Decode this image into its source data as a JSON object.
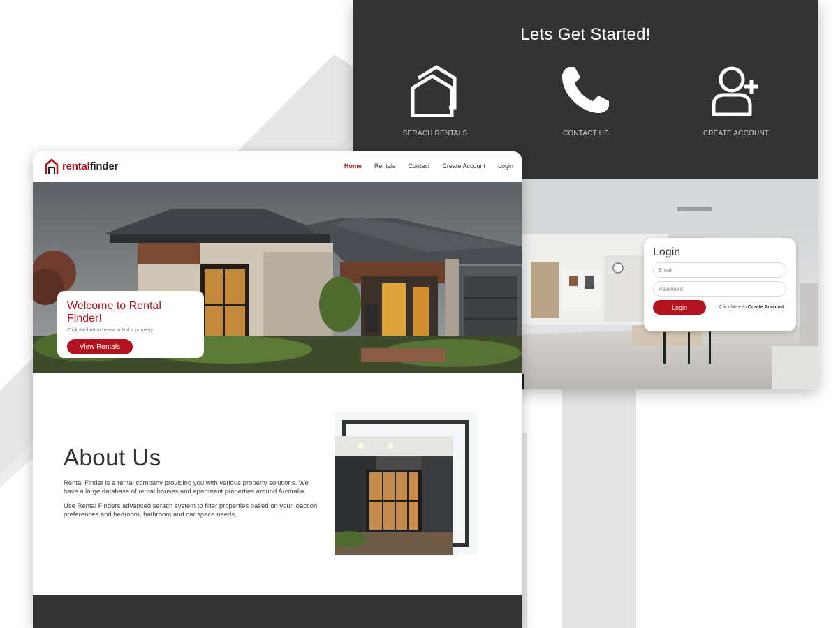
{
  "back": {
    "title": "Lets Get Started!",
    "actions": [
      {
        "label": "SERACH RENTALS",
        "icon": "house-icon"
      },
      {
        "label": "CONTACT US",
        "icon": "phone-icon"
      },
      {
        "label": "CREATE ACCOUNT",
        "icon": "add-user-icon"
      }
    ],
    "login": {
      "title": "Login",
      "email_placeholder": "Email",
      "password_placeholder": "Password",
      "button": "Login",
      "link_prefix": "Click here to ",
      "link_bold": "Create Account"
    }
  },
  "front": {
    "logo": {
      "part1": "rental",
      "part2": "finder"
    },
    "nav": [
      "Home",
      "Rentals",
      "Contact",
      "Create Account",
      "Login"
    ],
    "active_nav": "Home",
    "hero": {
      "title": "Welcome to Rental Finder!",
      "subtitle": "Click the button below to find a property",
      "button": "View Rentals"
    },
    "about": {
      "title": "About Us",
      "para1": "Rental Finder is a rental company providing you with various property solutions. We have a large database of rental houses and apartment properties around Australia.",
      "para2": "Use Rental Finders advanced serach system to filter properties based on your loaction preferences and bedroom, bathroom and car space needs."
    }
  },
  "colors": {
    "brand_red": "#b3121f",
    "dark": "#333333",
    "background": "#ffffff"
  }
}
